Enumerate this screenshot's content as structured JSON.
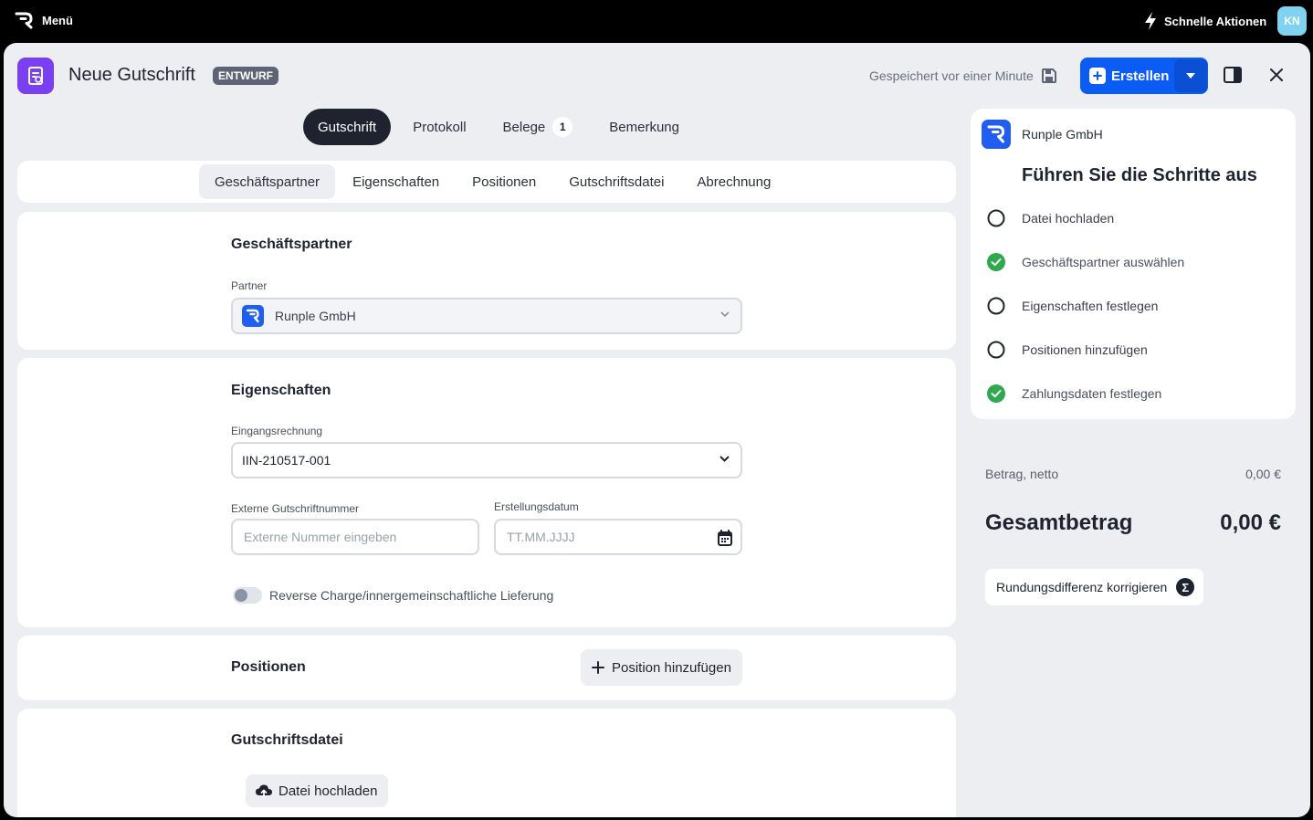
{
  "topbar": {
    "menu_label": "Menü",
    "quick_actions_label": "Schnelle Aktionen",
    "avatar_initials": "KN"
  },
  "header": {
    "title": "Neue Gutschrift",
    "status_badge": "ENTWURF",
    "saved_text": "Gespeichert vor einer Minute",
    "create_label": "Erstellen"
  },
  "main_tabs": [
    {
      "label": "Gutschrift",
      "active": true
    },
    {
      "label": "Protokoll"
    },
    {
      "label": "Belege",
      "count": "1"
    },
    {
      "label": "Bemerkung"
    }
  ],
  "sub_tabs": [
    {
      "label": "Geschäftspartner",
      "active": true
    },
    {
      "label": "Eigenschaften"
    },
    {
      "label": "Positionen"
    },
    {
      "label": "Gutschriftsdatei"
    },
    {
      "label": "Abrechnung"
    }
  ],
  "partner_section": {
    "title": "Geschäftspartner",
    "field_label": "Partner",
    "value": "Runple GmbH"
  },
  "properties_section": {
    "title": "Eigenschaften",
    "invoice_label": "Eingangsrechnung",
    "invoice_value": "IIN-210517-001",
    "external_label": "Externe Gutschriftnummer",
    "external_placeholder": "Externe Nummer eingeben",
    "date_label": "Erstellungsdatum",
    "date_placeholder": "TT.MM.JJJJ",
    "reverse_charge_label": "Reverse Charge/innergemeinschaftliche Lieferung",
    "reverse_charge_on": false
  },
  "positions_section": {
    "title": "Positionen",
    "add_label": "Position hinzufügen"
  },
  "file_section": {
    "title": "Gutschriftsdatei",
    "upload_label": "Datei hochladen"
  },
  "steps_panel": {
    "company": "Runple GmbH",
    "heading": "Führen Sie die Schritte aus",
    "steps": [
      {
        "label": "Datei hochladen",
        "done": false
      },
      {
        "label": "Geschäftspartner auswählen",
        "done": true
      },
      {
        "label": "Eigenschaften festlegen",
        "done": false
      },
      {
        "label": "Positionen hinzufügen",
        "done": false
      },
      {
        "label": "Zahlungsdaten festlegen",
        "done": true
      }
    ]
  },
  "summary": {
    "net_label": "Betrag, netto",
    "net_value": "0,00 €",
    "total_label": "Gesamtbetrag",
    "total_value": "0,00 €",
    "rounding_label": "Rundungsdifferenz korrigieren",
    "rounding_icon_char": "Σ"
  },
  "colors": {
    "primary": "#0b5cf4",
    "doc_icon": "#7b3ff2",
    "success": "#2fa84f",
    "dark": "#1f2330"
  },
  "icons": [
    "runple-logo-icon",
    "lightning-icon",
    "credit-note-icon",
    "save-icon",
    "plus-icon",
    "caret-down-icon",
    "panel-toggle-icon",
    "close-icon",
    "chevron-down-icon",
    "calendar-icon",
    "check-circle-icon",
    "circle-icon",
    "cloud-upload-icon",
    "sigma-icon"
  ]
}
